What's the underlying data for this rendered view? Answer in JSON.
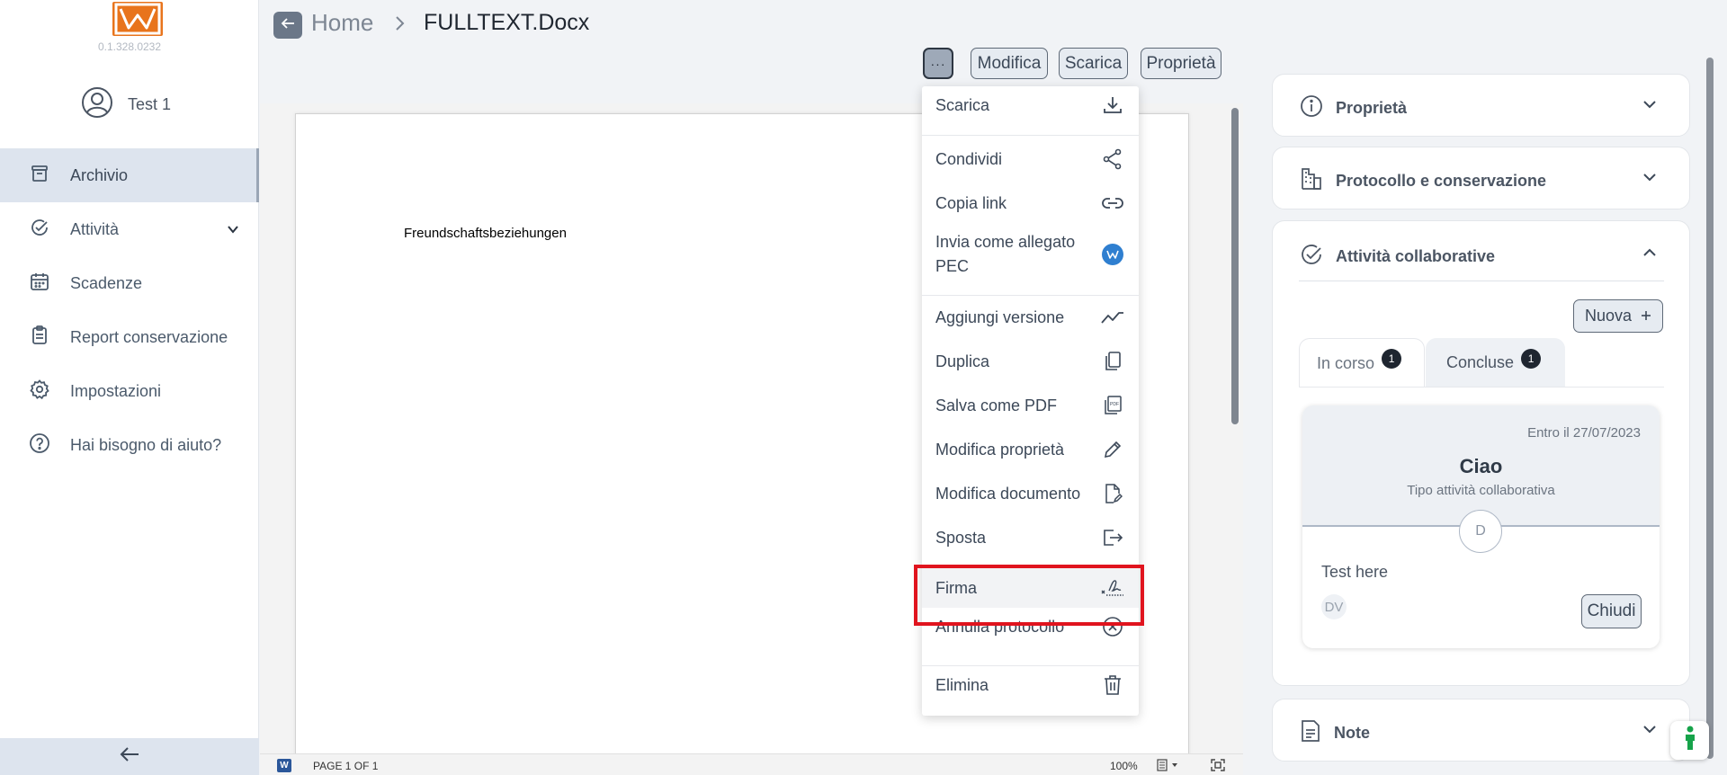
{
  "app": {
    "version": "0.1.328.0232",
    "user": "Test 1",
    "accent": "#e8741c"
  },
  "sidebar": {
    "items": [
      {
        "label": "Archivio",
        "icon": "archive-icon",
        "active": true
      },
      {
        "label": "Attività",
        "icon": "check-circle-icon",
        "expandable": true
      },
      {
        "label": "Scadenze",
        "icon": "calendar-icon"
      },
      {
        "label": "Report conservazione",
        "icon": "clipboard-icon"
      },
      {
        "label": "Impostazioni",
        "icon": "gear-icon"
      },
      {
        "label": "Hai bisogno di aiuto?",
        "icon": "help-icon"
      }
    ]
  },
  "header": {
    "breadcrumb_home": "Home",
    "file_name": "FULLTEXT.Docx",
    "more_label": "···",
    "buttons": {
      "edit": "Modifica",
      "download": "Scarica",
      "properties": "Proprietà"
    }
  },
  "document": {
    "text": "Freundschaftsbeziehungen",
    "page_info": "PAGE 1 OF 1",
    "zoom": "100%"
  },
  "menu": {
    "items": [
      {
        "label": "Scarica",
        "icon": "download-icon"
      },
      {
        "label": "Condividi",
        "icon": "share-icon"
      },
      {
        "label": "Copia link",
        "icon": "link-icon"
      },
      {
        "label": "Invia come allegato PEC",
        "line1": "Invia come allegato",
        "line2": "PEC",
        "icon": "pec-icon"
      },
      {
        "label": "Aggiungi versione",
        "icon": "trend-icon"
      },
      {
        "label": "Duplica",
        "icon": "copy-icon"
      },
      {
        "label": "Salva come PDF",
        "icon": "pdf-icon"
      },
      {
        "label": "Modifica proprietà",
        "icon": "pencil-icon"
      },
      {
        "label": "Modifica documento",
        "icon": "edit-document-icon"
      },
      {
        "label": "Sposta",
        "icon": "move-icon"
      },
      {
        "label": "Firma",
        "icon": "signature-icon",
        "highlighted": true
      },
      {
        "label": "Annulla protocollo",
        "icon": "cancel-circle-icon"
      },
      {
        "label": "Elimina",
        "icon": "trash-icon"
      }
    ]
  },
  "panel": {
    "properties": "Proprietà",
    "protocol": "Protocollo e conservazione",
    "collab": "Attività collaborative",
    "notes": "Note",
    "new_button": "Nuova",
    "tabs": [
      {
        "label": "In corso",
        "count": "1",
        "active": true
      },
      {
        "label": "Concluse",
        "count": "1"
      }
    ],
    "task": {
      "due": "Entro il 27/07/2023",
      "title": "Ciao",
      "type": "Tipo attività collaborativa",
      "avatar": "D",
      "description": "Test here",
      "assignee": "DV",
      "close_button": "Chiudi"
    }
  }
}
